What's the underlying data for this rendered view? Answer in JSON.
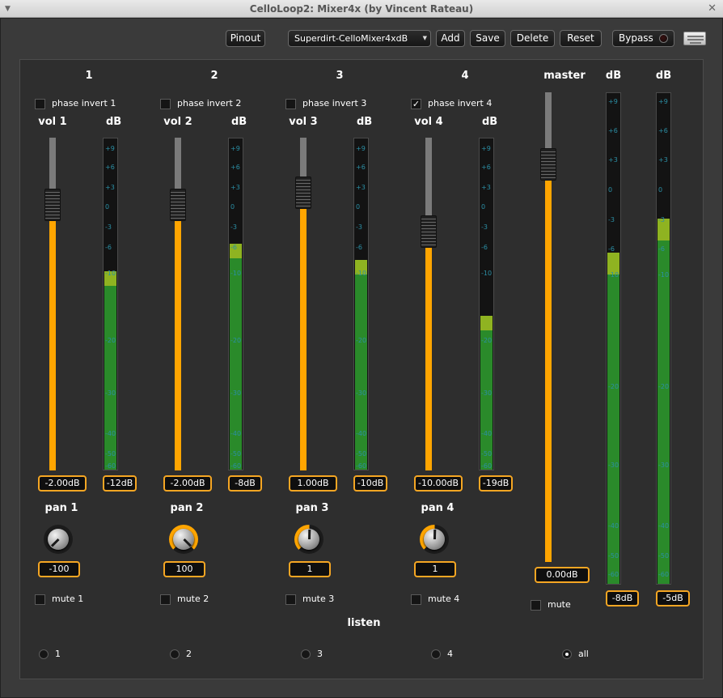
{
  "window": {
    "title": "CelloLoop2: Mixer4x (by Vincent Rateau)"
  },
  "toolbar": {
    "pinout": "Pinout",
    "preset": "Superdirt-CelloMixer4xdB",
    "add": "Add",
    "save": "Save",
    "delete": "Delete",
    "reset": "Reset",
    "bypass": "Bypass"
  },
  "channels": [
    {
      "num": "1",
      "phase_label": "phase invert 1",
      "phase_checked": false,
      "vol_label": "vol 1",
      "db_label": "dB",
      "vol_value": "-2.00dB",
      "vol_frac": 0.755,
      "meter_value": "-12dB",
      "meter_frac": 0.555,
      "pan_label": "pan 1",
      "pan_value": "-100",
      "pan_norm": -1.0,
      "mute_label": "mute 1",
      "listen_label": "1"
    },
    {
      "num": "2",
      "phase_label": "phase invert 2",
      "phase_checked": false,
      "vol_label": "vol 2",
      "db_label": "dB",
      "vol_value": "-2.00dB",
      "vol_frac": 0.755,
      "meter_value": "-8dB",
      "meter_frac": 0.638,
      "pan_label": "pan 2",
      "pan_value": "100",
      "pan_norm": 1.0,
      "mute_label": "mute 2",
      "listen_label": "2"
    },
    {
      "num": "3",
      "phase_label": "phase invert 3",
      "phase_checked": false,
      "vol_label": "vol 3",
      "db_label": "dB",
      "vol_value": "1.00dB",
      "vol_frac": 0.79,
      "meter_value": "-10dB",
      "meter_frac": 0.59,
      "pan_label": "pan 3",
      "pan_value": "1",
      "pan_norm": 0.01,
      "mute_label": "mute 3",
      "listen_label": "3"
    },
    {
      "num": "4",
      "phase_label": "phase invert 4",
      "phase_checked": true,
      "vol_label": "vol 4",
      "db_label": "dB",
      "vol_value": "-10.00dB",
      "vol_frac": 0.675,
      "meter_value": "-19dB",
      "meter_frac": 0.42,
      "pan_label": "pan 4",
      "pan_value": "1",
      "pan_norm": 0.01,
      "mute_label": "mute 4",
      "listen_label": "4"
    }
  ],
  "master": {
    "label": "master",
    "vol_value": "0.00dB",
    "vol_frac": 0.815,
    "mute_label": "mute",
    "meters": [
      {
        "label": "dB",
        "value": "-8dB",
        "frac": 0.63
      },
      {
        "label": "dB",
        "value": "-5dB",
        "frac": 0.7
      }
    ]
  },
  "meter_ticks_small": [
    "+9",
    "+6",
    "+3",
    "0",
    "-3",
    "-6",
    "-10",
    "-20",
    "-30",
    "-40",
    "-50",
    "-60"
  ],
  "meter_ticks_master": [
    "+9",
    "+6",
    "+3",
    "0",
    "-3",
    "-6",
    "-10",
    "-20",
    "-30",
    "-40",
    "-50",
    "-60"
  ],
  "listen": {
    "label": "listen",
    "all_label": "all",
    "selected": "all"
  },
  "colors": {
    "accent": "#ffa500",
    "meter_green": "#2a8a2a",
    "meter_peak": "#8fb321",
    "meter_tick": "#2b8fa5"
  }
}
